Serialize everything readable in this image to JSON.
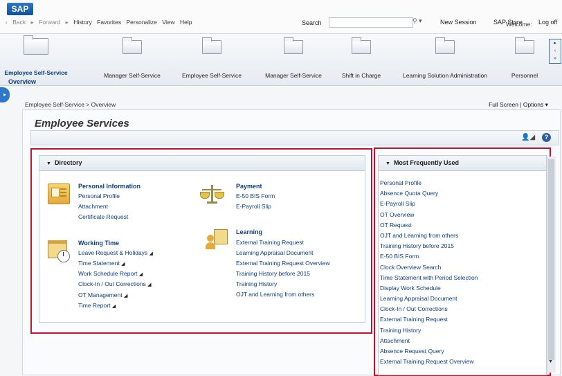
{
  "header": {
    "logo": "SAP",
    "nav": [
      "Back",
      "Forward",
      "History",
      "Favorites",
      "Personalize",
      "View",
      "Help"
    ],
    "search_label": "Search",
    "links": [
      "New Session",
      "SAP Store",
      "Log off"
    ],
    "welcome": "Welcome:"
  },
  "roles": [
    {
      "label": "Employee Self-Service",
      "active": true
    },
    {
      "label": "Manager Self-Service"
    },
    {
      "label": "Employee Self-Service"
    },
    {
      "label": "Manager Self-Service"
    },
    {
      "label": "Shift in Charge"
    },
    {
      "label": "Learning Solution Administration"
    },
    {
      "label": "Personnel"
    }
  ],
  "subtab": "Overview",
  "breadcrumb": "Employee Self-Service  >  Overview",
  "full_screen": "Full Screen | Options ▾",
  "page_title": "Employee Services",
  "directory": {
    "title": "Directory",
    "sections": {
      "personal": {
        "title": "Personal Information",
        "links": [
          "Personal Profile",
          "Attachment",
          "Certificate Request"
        ]
      },
      "payment": {
        "title": "Payment",
        "links": [
          "E-50 BIS Form",
          "E-Payroll Slip"
        ]
      },
      "working": {
        "title": "Working Time",
        "links": [
          "Leave Request & Holidays",
          "Time Statement",
          "Work Schedule Report",
          "Clock-In / Out Corrections",
          "OT Management",
          "Time Report"
        ]
      },
      "learning": {
        "title": "Learning",
        "links": [
          "External Training Request",
          "Learning Appraisal Document",
          "External Training Request Overview",
          "Training History before 2015",
          "Training History",
          "OJT and Learning from others"
        ]
      }
    }
  },
  "frequent": {
    "title": "Most Frequently Used",
    "items": [
      "Personal Profile",
      "Absence Quota Query",
      "E-Payroll Slip",
      "OT Overview",
      "OT Request",
      "OJT and Learning from others",
      "Training History before 2015",
      "E-50 BIS Form",
      "Clock Overview Search",
      "Time Statement with Period Selection",
      "Display Work Schedule",
      "Learning Appraisal Document",
      "Clock-In / Out Corrections",
      "External Training Request",
      "Training History",
      "Attachment",
      "Absence Request Query",
      "External Training Request Overview"
    ]
  }
}
